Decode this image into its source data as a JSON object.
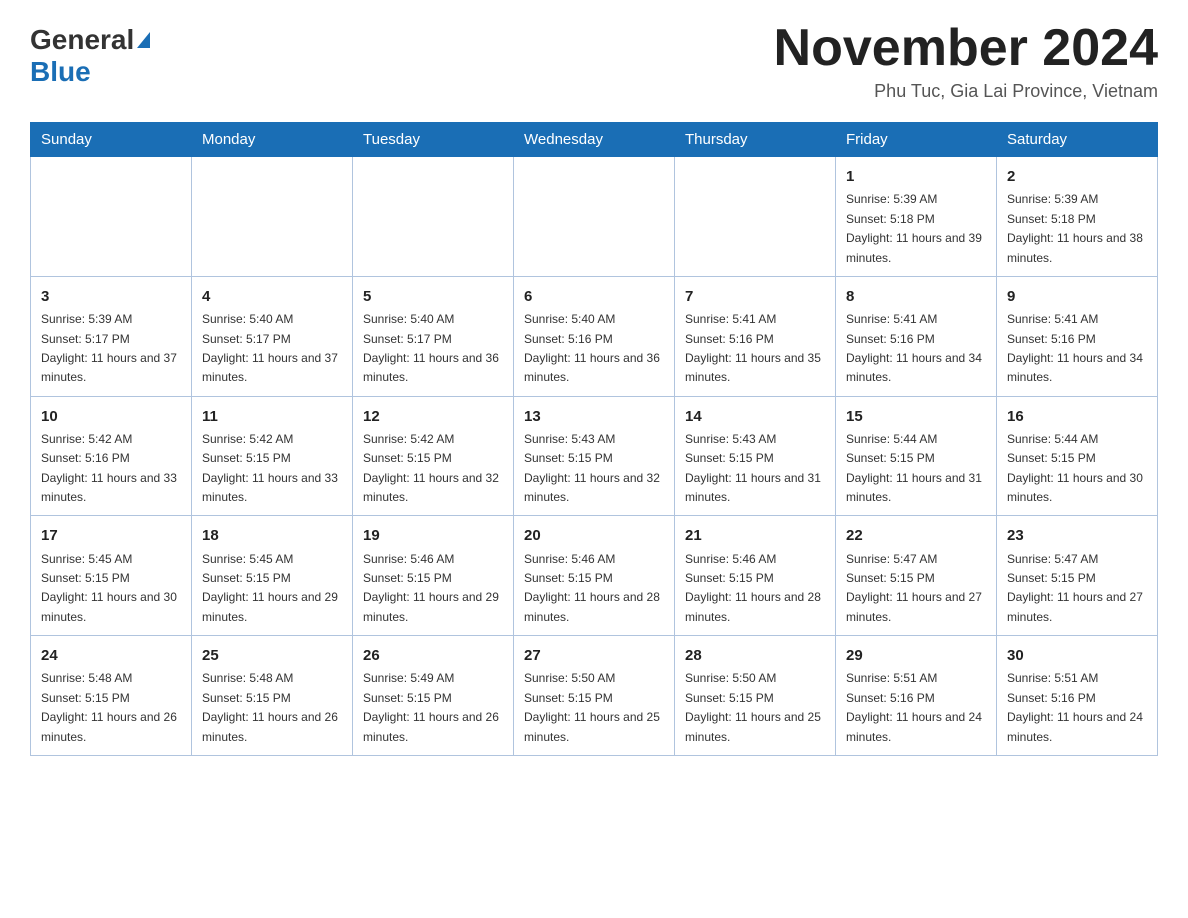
{
  "header": {
    "title": "November 2024",
    "location": "Phu Tuc, Gia Lai Province, Vietnam",
    "logo_general": "General",
    "logo_blue": "Blue"
  },
  "weekdays": [
    "Sunday",
    "Monday",
    "Tuesday",
    "Wednesday",
    "Thursday",
    "Friday",
    "Saturday"
  ],
  "weeks": [
    [
      {
        "day": "",
        "sunrise": "",
        "sunset": "",
        "daylight": ""
      },
      {
        "day": "",
        "sunrise": "",
        "sunset": "",
        "daylight": ""
      },
      {
        "day": "",
        "sunrise": "",
        "sunset": "",
        "daylight": ""
      },
      {
        "day": "",
        "sunrise": "",
        "sunset": "",
        "daylight": ""
      },
      {
        "day": "",
        "sunrise": "",
        "sunset": "",
        "daylight": ""
      },
      {
        "day": "1",
        "sunrise": "Sunrise: 5:39 AM",
        "sunset": "Sunset: 5:18 PM",
        "daylight": "Daylight: 11 hours and 39 minutes."
      },
      {
        "day": "2",
        "sunrise": "Sunrise: 5:39 AM",
        "sunset": "Sunset: 5:18 PM",
        "daylight": "Daylight: 11 hours and 38 minutes."
      }
    ],
    [
      {
        "day": "3",
        "sunrise": "Sunrise: 5:39 AM",
        "sunset": "Sunset: 5:17 PM",
        "daylight": "Daylight: 11 hours and 37 minutes."
      },
      {
        "day": "4",
        "sunrise": "Sunrise: 5:40 AM",
        "sunset": "Sunset: 5:17 PM",
        "daylight": "Daylight: 11 hours and 37 minutes."
      },
      {
        "day": "5",
        "sunrise": "Sunrise: 5:40 AM",
        "sunset": "Sunset: 5:17 PM",
        "daylight": "Daylight: 11 hours and 36 minutes."
      },
      {
        "day": "6",
        "sunrise": "Sunrise: 5:40 AM",
        "sunset": "Sunset: 5:16 PM",
        "daylight": "Daylight: 11 hours and 36 minutes."
      },
      {
        "day": "7",
        "sunrise": "Sunrise: 5:41 AM",
        "sunset": "Sunset: 5:16 PM",
        "daylight": "Daylight: 11 hours and 35 minutes."
      },
      {
        "day": "8",
        "sunrise": "Sunrise: 5:41 AM",
        "sunset": "Sunset: 5:16 PM",
        "daylight": "Daylight: 11 hours and 34 minutes."
      },
      {
        "day": "9",
        "sunrise": "Sunrise: 5:41 AM",
        "sunset": "Sunset: 5:16 PM",
        "daylight": "Daylight: 11 hours and 34 minutes."
      }
    ],
    [
      {
        "day": "10",
        "sunrise": "Sunrise: 5:42 AM",
        "sunset": "Sunset: 5:16 PM",
        "daylight": "Daylight: 11 hours and 33 minutes."
      },
      {
        "day": "11",
        "sunrise": "Sunrise: 5:42 AM",
        "sunset": "Sunset: 5:15 PM",
        "daylight": "Daylight: 11 hours and 33 minutes."
      },
      {
        "day": "12",
        "sunrise": "Sunrise: 5:42 AM",
        "sunset": "Sunset: 5:15 PM",
        "daylight": "Daylight: 11 hours and 32 minutes."
      },
      {
        "day": "13",
        "sunrise": "Sunrise: 5:43 AM",
        "sunset": "Sunset: 5:15 PM",
        "daylight": "Daylight: 11 hours and 32 minutes."
      },
      {
        "day": "14",
        "sunrise": "Sunrise: 5:43 AM",
        "sunset": "Sunset: 5:15 PM",
        "daylight": "Daylight: 11 hours and 31 minutes."
      },
      {
        "day": "15",
        "sunrise": "Sunrise: 5:44 AM",
        "sunset": "Sunset: 5:15 PM",
        "daylight": "Daylight: 11 hours and 31 minutes."
      },
      {
        "day": "16",
        "sunrise": "Sunrise: 5:44 AM",
        "sunset": "Sunset: 5:15 PM",
        "daylight": "Daylight: 11 hours and 30 minutes."
      }
    ],
    [
      {
        "day": "17",
        "sunrise": "Sunrise: 5:45 AM",
        "sunset": "Sunset: 5:15 PM",
        "daylight": "Daylight: 11 hours and 30 minutes."
      },
      {
        "day": "18",
        "sunrise": "Sunrise: 5:45 AM",
        "sunset": "Sunset: 5:15 PM",
        "daylight": "Daylight: 11 hours and 29 minutes."
      },
      {
        "day": "19",
        "sunrise": "Sunrise: 5:46 AM",
        "sunset": "Sunset: 5:15 PM",
        "daylight": "Daylight: 11 hours and 29 minutes."
      },
      {
        "day": "20",
        "sunrise": "Sunrise: 5:46 AM",
        "sunset": "Sunset: 5:15 PM",
        "daylight": "Daylight: 11 hours and 28 minutes."
      },
      {
        "day": "21",
        "sunrise": "Sunrise: 5:46 AM",
        "sunset": "Sunset: 5:15 PM",
        "daylight": "Daylight: 11 hours and 28 minutes."
      },
      {
        "day": "22",
        "sunrise": "Sunrise: 5:47 AM",
        "sunset": "Sunset: 5:15 PM",
        "daylight": "Daylight: 11 hours and 27 minutes."
      },
      {
        "day": "23",
        "sunrise": "Sunrise: 5:47 AM",
        "sunset": "Sunset: 5:15 PM",
        "daylight": "Daylight: 11 hours and 27 minutes."
      }
    ],
    [
      {
        "day": "24",
        "sunrise": "Sunrise: 5:48 AM",
        "sunset": "Sunset: 5:15 PM",
        "daylight": "Daylight: 11 hours and 26 minutes."
      },
      {
        "day": "25",
        "sunrise": "Sunrise: 5:48 AM",
        "sunset": "Sunset: 5:15 PM",
        "daylight": "Daylight: 11 hours and 26 minutes."
      },
      {
        "day": "26",
        "sunrise": "Sunrise: 5:49 AM",
        "sunset": "Sunset: 5:15 PM",
        "daylight": "Daylight: 11 hours and 26 minutes."
      },
      {
        "day": "27",
        "sunrise": "Sunrise: 5:50 AM",
        "sunset": "Sunset: 5:15 PM",
        "daylight": "Daylight: 11 hours and 25 minutes."
      },
      {
        "day": "28",
        "sunrise": "Sunrise: 5:50 AM",
        "sunset": "Sunset: 5:15 PM",
        "daylight": "Daylight: 11 hours and 25 minutes."
      },
      {
        "day": "29",
        "sunrise": "Sunrise: 5:51 AM",
        "sunset": "Sunset: 5:16 PM",
        "daylight": "Daylight: 11 hours and 24 minutes."
      },
      {
        "day": "30",
        "sunrise": "Sunrise: 5:51 AM",
        "sunset": "Sunset: 5:16 PM",
        "daylight": "Daylight: 11 hours and 24 minutes."
      }
    ]
  ]
}
